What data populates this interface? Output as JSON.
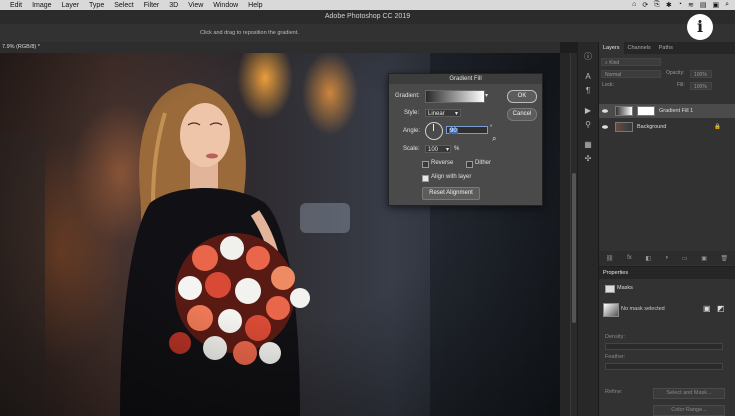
{
  "menubar": {
    "items": [
      "Edit",
      "Image",
      "Layer",
      "Type",
      "Select",
      "Filter",
      "3D",
      "View",
      "Window",
      "Help"
    ],
    "status": [
      "⌂",
      "⟳",
      "⎘",
      "✱",
      "◔",
      "≋",
      "▤",
      "▣",
      "⌕"
    ]
  },
  "app": {
    "title": "Adobe Photoshop CC 2019"
  },
  "options_bar": {
    "hint": "Click and drag to reposition the gradient."
  },
  "document": {
    "tab_label": "7.9% (RGB/8) *"
  },
  "dialog": {
    "title": "Gradient Fill",
    "gradient_label": "Gradient:",
    "style_label": "Style:",
    "style_value": "Linear",
    "angle_label": "Angle:",
    "angle_value": "90",
    "angle_unit": "°",
    "scale_label": "Scale:",
    "scale_value": "100",
    "scale_unit": "%",
    "reverse_label": "Reverse",
    "dither_label": "Dither",
    "align_label": "Align with layer",
    "reset_label": "Reset Alignment",
    "ok_label": "OK",
    "cancel_label": "Cancel",
    "checks": {
      "reverse": false,
      "dither": false,
      "align": true
    }
  },
  "layers_panel": {
    "tabs": [
      "Layers",
      "Channels",
      "Paths"
    ],
    "kind_label": "Kind",
    "blend_mode": "Normal",
    "opacity_label": "Opacity:",
    "opacity_value": "100%",
    "lock_label": "Lock:",
    "fill_label": "Fill:",
    "fill_value": "100%",
    "layers": [
      {
        "name": "Gradient Fill 1",
        "selected": true
      },
      {
        "name": "Background",
        "selected": false
      }
    ],
    "bottom_icons": [
      "⛓",
      "fx",
      "◧",
      "◑",
      "▭",
      "▣",
      "🗑"
    ]
  },
  "properties_panel": {
    "title": "Properties",
    "section": "Masks",
    "mask_status": "No mask selected",
    "density_label": "Density:",
    "feather_label": "Feather:",
    "refine_label": "Refine:",
    "select_mask_label": "Select and Mask...",
    "color_range_label": "Color Range..."
  },
  "info_overlay": {
    "glyph": "i"
  }
}
